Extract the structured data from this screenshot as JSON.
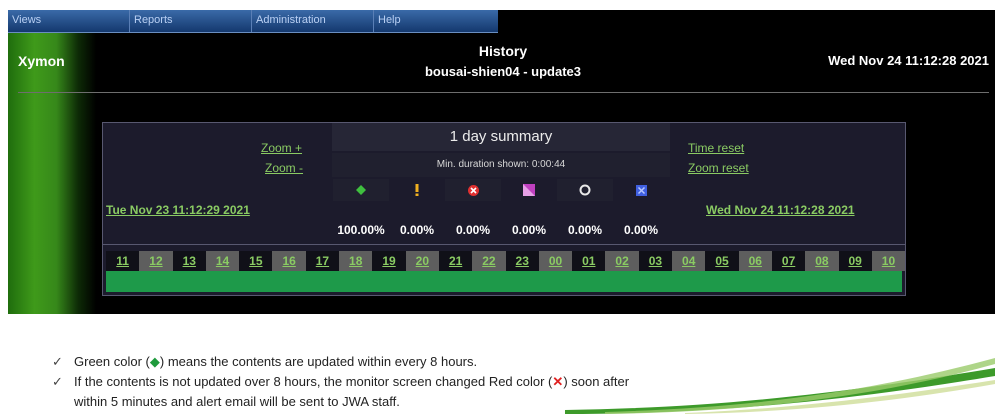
{
  "menu": [
    "Views",
    "Reports",
    "Administration",
    "Help"
  ],
  "header": {
    "brand": "Xymon",
    "title": "History",
    "subtitle": "bousai-shien04 - update3",
    "datetime": "Wed Nov 24 11:12:28 2021"
  },
  "summary": {
    "zoom_in": "Zoom +",
    "zoom_out": "Zoom -",
    "time_reset": "Time reset",
    "zoom_reset": "Zoom reset",
    "heading": "1 day summary",
    "min_duration": "Min. duration shown: 0:00:44",
    "start_date": "Tue Nov 23 11:12:29 2021",
    "end_date": "Wed Nov 24 11:12:28 2021",
    "status_icons": [
      {
        "icon": "green-diamond-icon",
        "color": "#3fbf3f"
      },
      {
        "icon": "yellow-exclamation-icon",
        "color": "#f0b020"
      },
      {
        "icon": "red-x-icon",
        "color": "#e03030"
      },
      {
        "icon": "purple-clear-icon",
        "color": "#c040c0"
      },
      {
        "icon": "white-circle-icon",
        "color": "#e8e8e8"
      },
      {
        "icon": "blue-square-icon",
        "color": "#4060e0"
      }
    ],
    "percentages": [
      "100.00%",
      "0.00%",
      "0.00%",
      "0.00%",
      "0.00%",
      "0.00%"
    ]
  },
  "hours": [
    "11",
    "12",
    "13",
    "14",
    "15",
    "16",
    "17",
    "18",
    "19",
    "20",
    "21",
    "22",
    "23",
    "00",
    "01",
    "02",
    "03",
    "04",
    "05",
    "06",
    "07",
    "08",
    "09",
    "10"
  ],
  "notes": {
    "line1_pre": "Green color (",
    "line1_post": ") means the contents are updated within every 8 hours.",
    "line2_pre": "If the contents is not updated over 8 hours, the monitor screen changed Red color (",
    "line2_post": ") soon after",
    "line3": "within 5 minutes and  alert email will be sent to JWA staff."
  }
}
